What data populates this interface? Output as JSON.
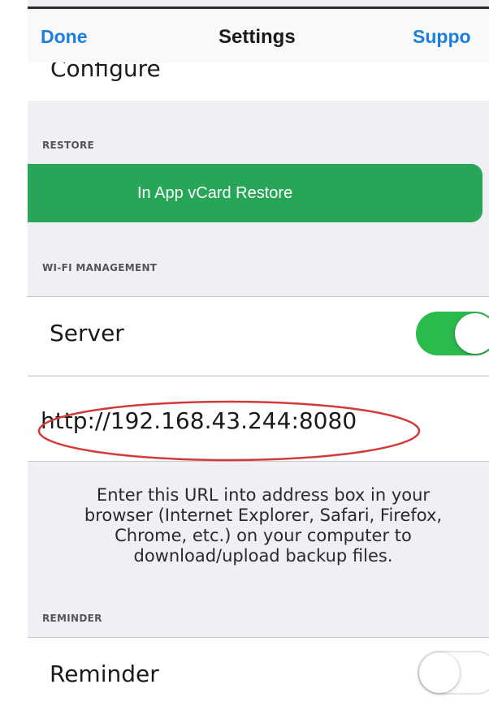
{
  "nav": {
    "left_label": "Done",
    "title": "Settings",
    "right_label": "Suppo"
  },
  "configure": {
    "label": "Configure"
  },
  "restore": {
    "header": "RESTORE",
    "button_label": "In App vCard Restore",
    "button_color": "#26a656"
  },
  "wifi": {
    "header": "WI-FI MANAGEMENT",
    "server_label": "Server",
    "server_enabled": true,
    "url": "http://192.168.43.244:8080",
    "annotation_color": "#d23a3a",
    "instructions": "Enter this URL into address box in your\nbrowser (Internet Explorer, Safari, Firefox,\nChrome, etc.) on your computer to\ndownload/upload backup files."
  },
  "reminder": {
    "header": "REMINDER",
    "label": "Reminder",
    "enabled": false
  },
  "colors": {
    "accent_blue": "#1b7fe0",
    "toggle_on": "#2bbb4d",
    "background": "#efeff4"
  }
}
